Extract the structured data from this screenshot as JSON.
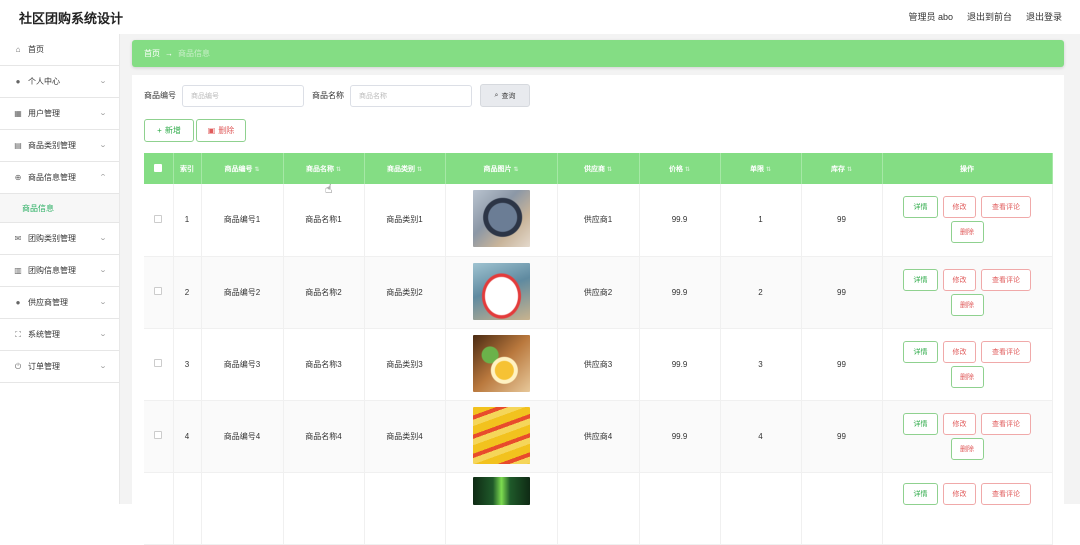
{
  "app": {
    "title": "社区团购系统设计"
  },
  "topnav": {
    "user": "管理员 abo",
    "exit_front": "退出到前台",
    "logout": "退出登录"
  },
  "sidebar": {
    "items": [
      {
        "label": "首页"
      },
      {
        "label": "个人中心"
      },
      {
        "label": "用户管理"
      },
      {
        "label": "商品类别管理"
      },
      {
        "label": "商品信息管理"
      },
      {
        "label": "商品信息"
      },
      {
        "label": "团购类别管理"
      },
      {
        "label": "团购信息管理"
      },
      {
        "label": "供应商管理"
      },
      {
        "label": "系统管理"
      },
      {
        "label": "订单管理"
      }
    ]
  },
  "breadcrumb": {
    "home": "首页",
    "arrow": "→",
    "current": "商品信息"
  },
  "search": {
    "code_label": "商品编号",
    "code_placeholder": "商品编号",
    "name_label": "商品名称",
    "name_placeholder": "商品名称",
    "query_label": "查询"
  },
  "actions": {
    "add_label": "新增",
    "delete_label": "删除"
  },
  "table": {
    "headers": [
      "索引",
      "商品编号",
      "商品名称",
      "商品类别",
      "商品图片",
      "供应商",
      "价格",
      "单限",
      "库存",
      "操作"
    ],
    "ops": {
      "detail": "详情",
      "edit": "修改",
      "review": "查看评论",
      "delete": "删除"
    },
    "rows": [
      {
        "index": "1",
        "code": "商品编号1",
        "name": "商品名称1",
        "category": "商品类别1",
        "supplier": "供应商1",
        "price": "99.9",
        "limit": "1",
        "stock": "99"
      },
      {
        "index": "2",
        "code": "商品编号2",
        "name": "商品名称2",
        "category": "商品类别2",
        "supplier": "供应商2",
        "price": "99.9",
        "limit": "2",
        "stock": "99"
      },
      {
        "index": "3",
        "code": "商品编号3",
        "name": "商品名称3",
        "category": "商品类别3",
        "supplier": "供应商3",
        "price": "99.9",
        "limit": "3",
        "stock": "99"
      },
      {
        "index": "4",
        "code": "商品编号4",
        "name": "商品名称4",
        "category": "商品类别4",
        "supplier": "供应商4",
        "price": "99.9",
        "limit": "4",
        "stock": "99"
      },
      {
        "index": "",
        "code": "",
        "name": "",
        "category": "",
        "supplier": "",
        "price": "",
        "limit": "",
        "stock": ""
      }
    ]
  },
  "colors": {
    "accent": "#84dd84",
    "danger": "#e05b5b",
    "success": "#2eab49"
  }
}
